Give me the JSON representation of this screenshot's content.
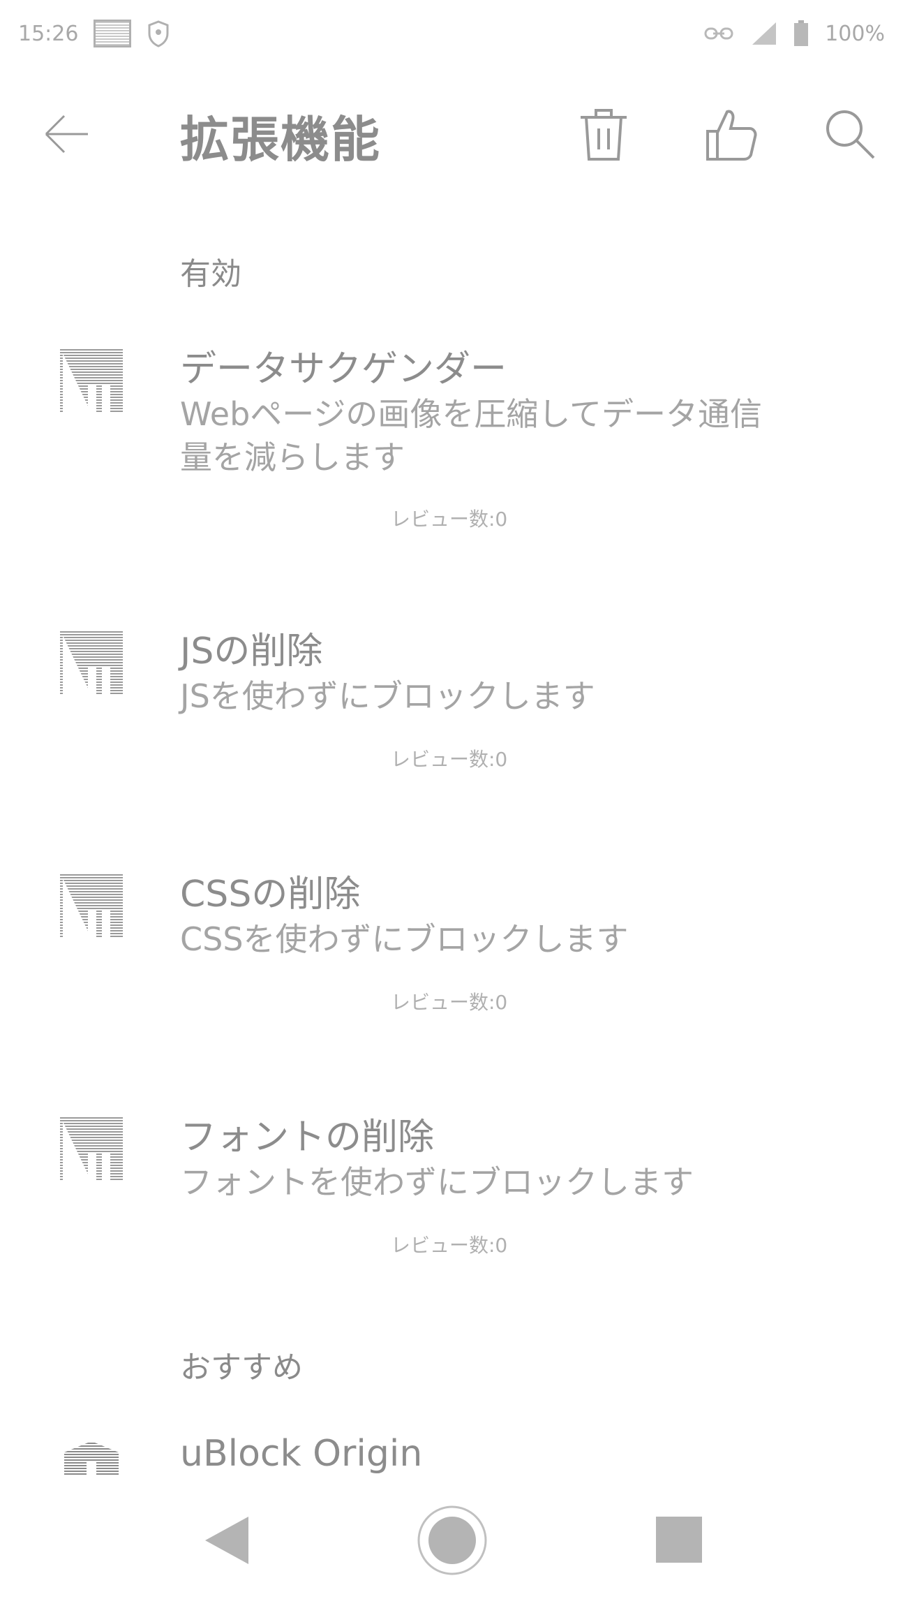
{
  "status_bar": {
    "time": "15:26",
    "battery": "100%"
  },
  "app_bar": {
    "title": "拡張機能"
  },
  "icons": {
    "back": "back-arrow-icon",
    "trash": "trash-icon",
    "like": "thumbs-up-icon",
    "search": "search-icon"
  },
  "sections": {
    "enabled": "有効",
    "recommended": "おすすめ"
  },
  "extensions": [
    {
      "title": "データサクゲンダー",
      "description": "Webページの画像を圧縮してデータ通信量を減らします",
      "reviews": "レビュー数:0"
    },
    {
      "title": "JSの削除",
      "description": "JSを使わずにブロックします",
      "reviews": "レビュー数:0"
    },
    {
      "title": "CSSの削除",
      "description": "CSSを使わずにブロックします",
      "reviews": "レビュー数:0"
    },
    {
      "title": "フォントの削除",
      "description": "フォントを使わずにブロックします",
      "reviews": "レビュー数:0"
    }
  ],
  "recommended": [
    {
      "title": "uBlock Origin"
    }
  ],
  "colors": {
    "text_primary": "#8c8c8c",
    "text_secondary": "#a4a4a4",
    "icon": "#999999"
  }
}
